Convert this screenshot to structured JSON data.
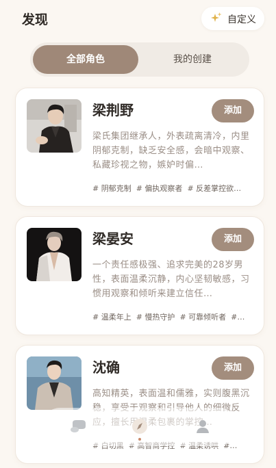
{
  "header": {
    "title": "发现",
    "custom_label": "自定义",
    "custom_icon": "sparkle-icon"
  },
  "segments": {
    "all_roles": "全部角色",
    "my_creations": "我的创建",
    "active": "all_roles"
  },
  "cards": [
    {
      "name": "梁荆野",
      "add_label": "添加",
      "description": "梁氏集团继承人，外表疏离清冷，内里阴郁克制，缺乏安全感，会暗中观察、私藏珍视之物，嫉妒时偏…",
      "tags": [
        "# 阴郁克制",
        "# 偏执观察者",
        "# 反差掌控欲…"
      ]
    },
    {
      "name": "梁晏安",
      "add_label": "添加",
      "description": "一个责任感极强、追求完美的28岁男性，表面温柔沉静，内心坚韧敏感，习惯用观察和倾听来建立信任…",
      "tags": [
        "# 温柔年上",
        "# 慢热守护",
        "# 可靠倾听者",
        "#…"
      ]
    },
    {
      "name": "沈确",
      "add_label": "添加",
      "description": "高知精英，表面温和儒雅，实则腹黑沉稳，享受于观察和引导他人的细微反应，擅长用温柔包裹的掌控…",
      "tags": [
        "# 白切黑",
        "# 高智商学控",
        "# 温柔诱哄",
        "#…"
      ]
    }
  ],
  "nav": {
    "items": [
      "chat-icon",
      "discover-icon",
      "profile-icon"
    ],
    "active": "discover-icon"
  },
  "colors": {
    "background": "#fbf7f2",
    "accent": "#a38d7d",
    "segment_active": "#9f8878",
    "nav_active_dot": "#c9896a"
  }
}
